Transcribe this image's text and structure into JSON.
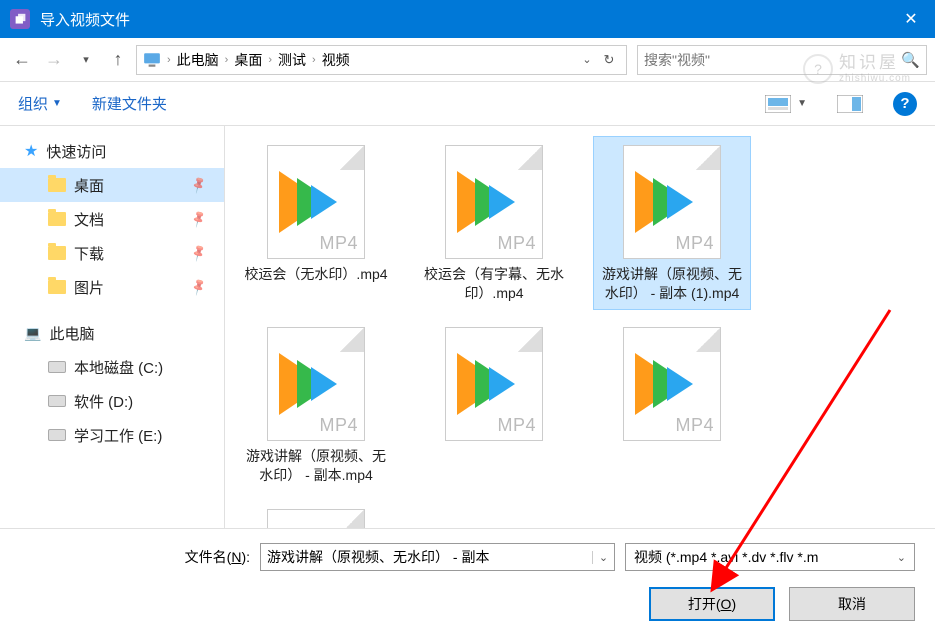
{
  "title": "导入视频文件",
  "breadcrumb": [
    "此电脑",
    "桌面",
    "测试",
    "视频"
  ],
  "search_placeholder": "搜索\"视频\"",
  "toolbar": {
    "organize": "组织",
    "newfolder": "新建文件夹"
  },
  "sidebar": {
    "quick": "快速访问",
    "quick_items": [
      "桌面",
      "文档",
      "下载",
      "图片"
    ],
    "thispc": "此电脑",
    "drives": [
      "本地磁盘 (C:)",
      "软件 (D:)",
      "学习工作 (E:)"
    ]
  },
  "files": [
    {
      "name": "校运会（无水印）.mp4",
      "ext": "MP4",
      "selected": false
    },
    {
      "name": "校运会（有字幕、无水印）.mp4",
      "ext": "MP4",
      "selected": false
    },
    {
      "name": "游戏讲解（原视频、无水印） - 副本 (1).mp4",
      "ext": "MP4",
      "selected": true
    },
    {
      "name": "游戏讲解（原视频、无水印） - 副本.mp4",
      "ext": "MP4",
      "selected": false
    },
    {
      "name": "",
      "ext": "MP4",
      "selected": false
    },
    {
      "name": "",
      "ext": "MP4",
      "selected": false
    },
    {
      "name": "",
      "ext": "MP4",
      "selected": false
    }
  ],
  "filename_label_pre": "文件名(",
  "filename_label_key": "N",
  "filename_label_post": "):",
  "filename_value": "游戏讲解（原视频、无水印） - 副本",
  "filetype": "视频 (*.mp4 *.avi *.dv *.flv *.m",
  "open_btn_pre": "打开(",
  "open_btn_key": "O",
  "open_btn_post": ")",
  "cancel_btn": "取消",
  "watermark_big": "知识屋",
  "watermark_small": "zhishiwu.com"
}
